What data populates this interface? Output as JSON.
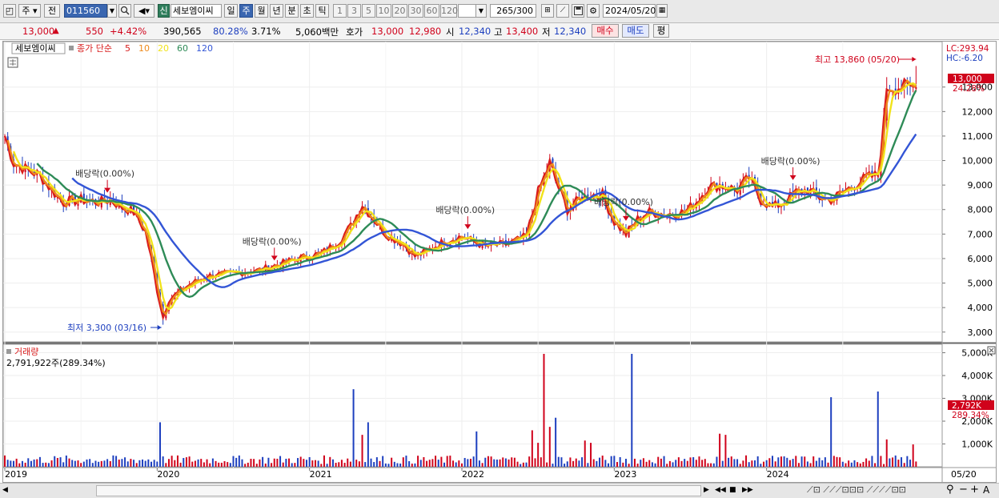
{
  "toolbar": {
    "market": "주",
    "prev_label": "전",
    "code": "011560",
    "new_badge": "신",
    "stock_name": "세보엠이씨",
    "periods": [
      "일",
      "주",
      "월",
      "년",
      "분",
      "초",
      "틱"
    ],
    "active_period": "주",
    "minutes": [
      "1",
      "3",
      "5",
      "10",
      "20",
      "30",
      "60",
      "120"
    ],
    "count": "265",
    "count_total": "/300",
    "date": "2024/05/20"
  },
  "quote": {
    "price": "13,000",
    "change": "550",
    "change_pct": "+4.42%",
    "volume": "390,565",
    "ratio": "80.28%",
    "turnover": "3.71%",
    "amount": "5,060백만",
    "ask_label": "호가",
    "ask": "13,000",
    "bid": "12,980",
    "open_label": "시",
    "open": "12,340",
    "high_label": "고",
    "high": "13,400",
    "low_label": "저",
    "low": "12,340",
    "buy_label": "매수",
    "sell_label": "매도",
    "avg_label": "평"
  },
  "price_panel": {
    "stock_label": "세보엠이씨",
    "ma_prefix": "종가 단순",
    "ma_periods": [
      "5",
      "10",
      "20",
      "60",
      "120"
    ],
    "ma_colors": [
      "#d91c1c",
      "#ee8a1c",
      "#f1e31a",
      "#2e8b57",
      "#3355d6"
    ],
    "lc": "LC:293.94",
    "hc": "HC:-6.20",
    "high_note": "최고 13,860 (05/20)",
    "low_note": "최저 3,300 (03/16)",
    "last_price": "13,000",
    "last_pct": "24.28%",
    "dividend_label": "배당락(0.00%)"
  },
  "volume_panel": {
    "title": "거래량",
    "value_text": "2,791,922주(289.34%)",
    "last_vol_tag": "2,792K",
    "last_vol_pct": "289.34%"
  },
  "x_axis": {
    "years": [
      "2019",
      "2020",
      "2021",
      "2022",
      "2023",
      "2024"
    ],
    "end_label": "05/20"
  },
  "chart_data": [
    {
      "type": "line",
      "y_ticks": [
        3000,
        4000,
        5000,
        6000,
        7000,
        8000,
        9000,
        10000,
        11000,
        12000,
        13000
      ],
      "ylim": [
        2600,
        14200
      ],
      "x_ticks": [
        "2019",
        "2020",
        "2021",
        "2022",
        "2023",
        "2024",
        "05/20"
      ],
      "close_anchors": [
        [
          0,
          11000
        ],
        [
          3,
          9900
        ],
        [
          8,
          9600
        ],
        [
          12,
          9400
        ],
        [
          16,
          8800
        ],
        [
          20,
          8300
        ],
        [
          26,
          8400
        ],
        [
          32,
          8300
        ],
        [
          36,
          8400
        ],
        [
          40,
          8100
        ],
        [
          44,
          7900
        ],
        [
          48,
          7100
        ],
        [
          50,
          6000
        ],
        [
          52,
          4700
        ],
        [
          54,
          3600
        ],
        [
          56,
          4300
        ],
        [
          60,
          4700
        ],
        [
          64,
          5000
        ],
        [
          70,
          5300
        ],
        [
          78,
          5400
        ],
        [
          86,
          5500
        ],
        [
          92,
          5700
        ],
        [
          100,
          6000
        ],
        [
          108,
          6200
        ],
        [
          114,
          6700
        ],
        [
          118,
          7300
        ],
        [
          122,
          8200
        ],
        [
          126,
          7600
        ],
        [
          130,
          7000
        ],
        [
          136,
          6600
        ],
        [
          140,
          6100
        ],
        [
          144,
          6300
        ],
        [
          150,
          6700
        ],
        [
          156,
          6900
        ],
        [
          164,
          6500
        ],
        [
          172,
          6600
        ],
        [
          178,
          6900
        ],
        [
          182,
          8700
        ],
        [
          186,
          9900
        ],
        [
          188,
          9200
        ],
        [
          192,
          8000
        ],
        [
          196,
          8400
        ],
        [
          200,
          8600
        ],
        [
          204,
          8600
        ],
        [
          208,
          7500
        ],
        [
          212,
          7000
        ],
        [
          216,
          7600
        ],
        [
          220,
          7900
        ],
        [
          226,
          7800
        ],
        [
          232,
          7900
        ],
        [
          236,
          8300
        ],
        [
          240,
          8900
        ],
        [
          244,
          9000
        ],
        [
          250,
          8800
        ],
        [
          254,
          9300
        ],
        [
          258,
          8400
        ],
        [
          262,
          8100
        ],
        [
          266,
          8300
        ],
        [
          270,
          8700
        ],
        [
          274,
          8800
        ],
        [
          278,
          8500
        ],
        [
          282,
          8400
        ],
        [
          286,
          8700
        ],
        [
          290,
          9000
        ],
        [
          294,
          9300
        ],
        [
          298,
          9400
        ],
        [
          300,
          11500
        ],
        [
          301,
          13000
        ]
      ],
      "ma_lines": [
        {
          "name": "5",
          "color": "#d91c1c"
        },
        {
          "name": "10",
          "color": "#ee8a1c"
        },
        {
          "name": "20",
          "color": "#f1e31a"
        },
        {
          "name": "60",
          "color": "#2e8b57"
        },
        {
          "name": "120",
          "color": "#3355d6"
        }
      ],
      "high_point": {
        "value": 13860,
        "date": "05/20"
      },
      "low_point": {
        "value": 3300,
        "date": "03/16"
      },
      "dividend_weeks": [
        35,
        92,
        158,
        212,
        269
      ]
    },
    {
      "type": "bar",
      "title": "거래량",
      "y_ticks": [
        1000,
        2000,
        3000,
        4000,
        5000
      ],
      "ylim": [
        0,
        5300
      ],
      "unit": "K",
      "spikes": [
        [
          53,
          1950
        ],
        [
          119,
          3400
        ],
        [
          122,
          1400
        ],
        [
          124,
          1950
        ],
        [
          161,
          1550
        ],
        [
          180,
          1600
        ],
        [
          182,
          1050
        ],
        [
          184,
          4950
        ],
        [
          186,
          1750
        ],
        [
          188,
          2150
        ],
        [
          198,
          1150
        ],
        [
          200,
          1050
        ],
        [
          214,
          4950
        ],
        [
          244,
          1450
        ],
        [
          246,
          1400
        ],
        [
          282,
          3050
        ],
        [
          298,
          3300
        ],
        [
          301,
          1200
        ],
        [
          310,
          980
        ],
        [
          312,
          2792
        ]
      ],
      "last_volume_k": 2792
    }
  ]
}
